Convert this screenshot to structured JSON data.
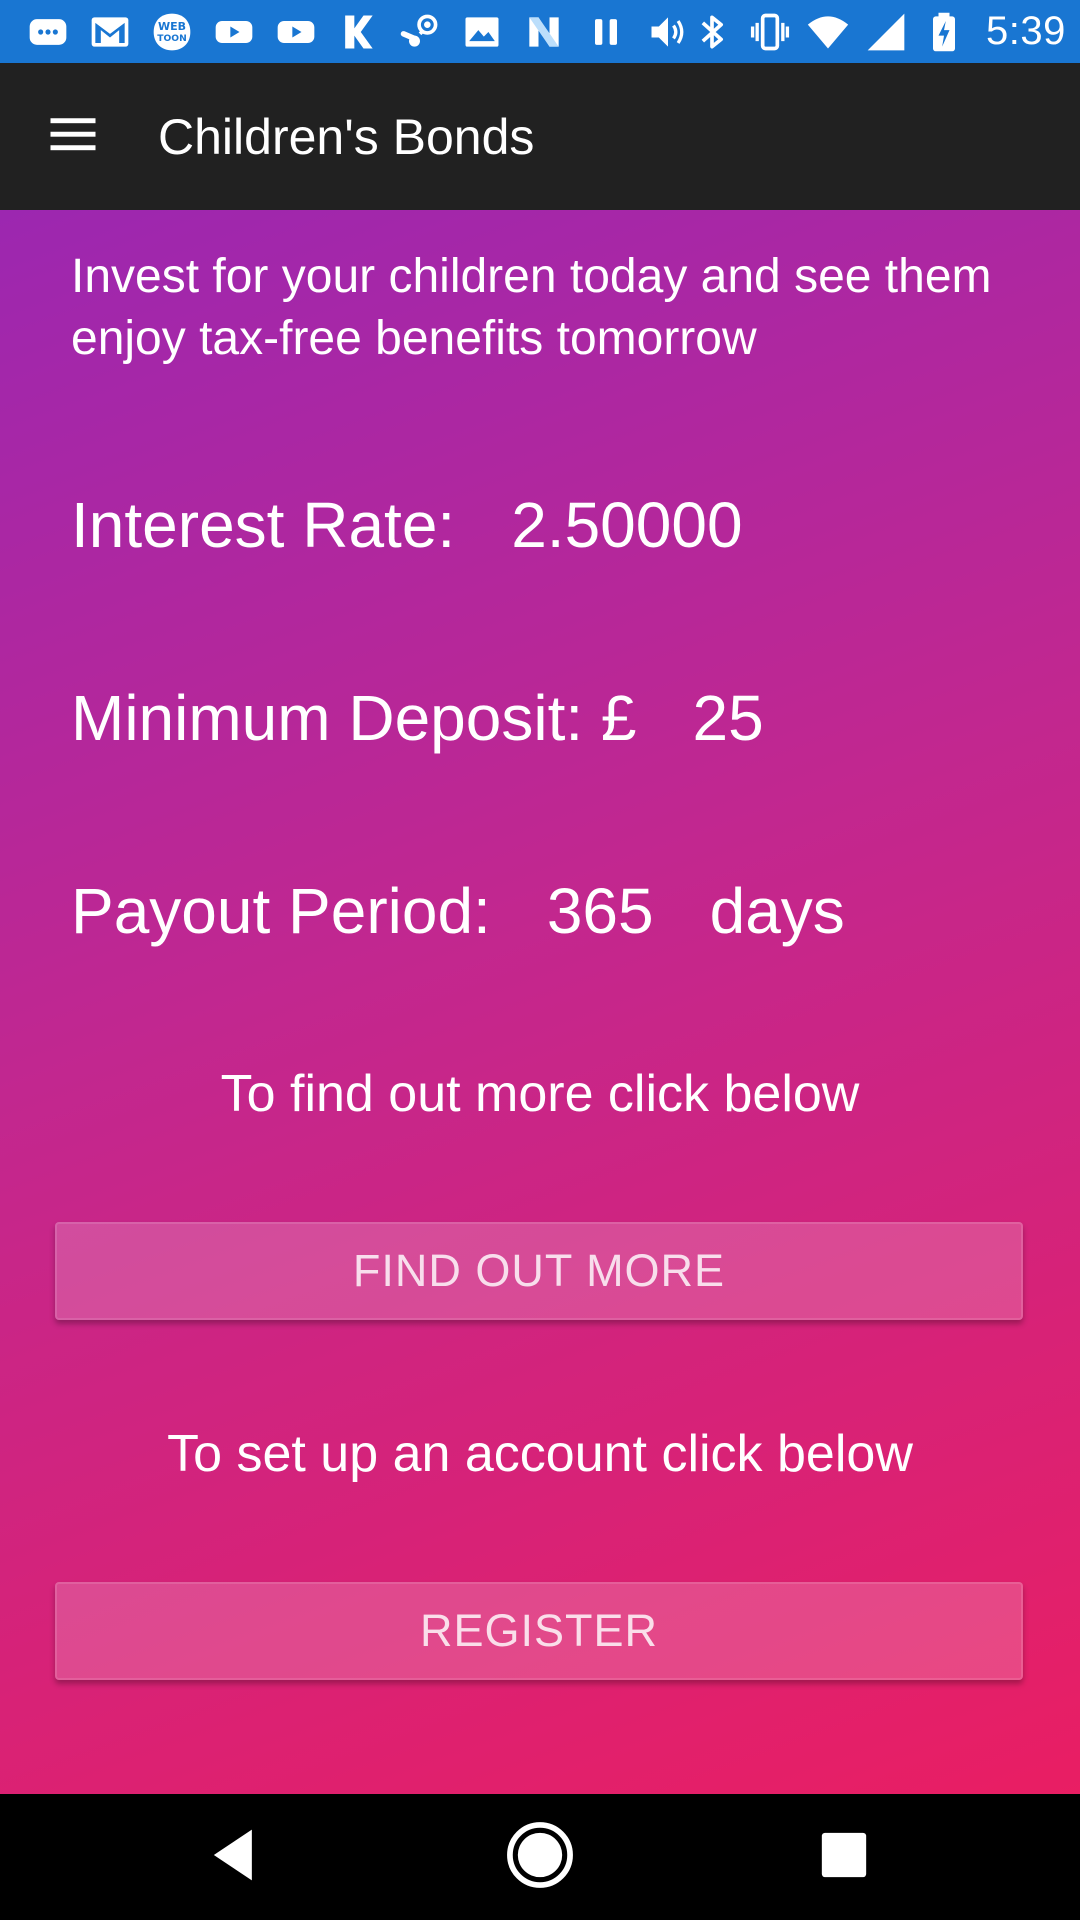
{
  "status_bar": {
    "time": "5:39",
    "left_icons": [
      "messages-icon",
      "gmail-icon",
      "webtoon-icon",
      "youtube-icon",
      "youtube-icon",
      "k-app-icon",
      "steam-icon",
      "photos-icon",
      "n-app-icon",
      "pause-icon",
      "volume-icon"
    ],
    "right_icons": [
      "bluetooth-icon",
      "vibrate-icon",
      "wifi-icon",
      "cell-signal-icon",
      "battery-charging-icon"
    ],
    "background": "#1976d2"
  },
  "app_bar": {
    "title": "Children's Bonds",
    "menu_icon": "hamburger-menu-icon",
    "background": "#212121"
  },
  "content": {
    "tagline": "Invest for your children today and see them enjoy tax-free benefits tomorrow",
    "interest_rate_label": "Interest Rate:",
    "interest_rate_value": "2.50000",
    "min_deposit_label": "Minimum Deposit: £",
    "min_deposit_value": "25",
    "payout_label": "Payout Period:",
    "payout_value": "365",
    "payout_unit": "days",
    "find_out_prompt": "To find out more click below",
    "find_out_button": "FIND OUT MORE",
    "account_prompt": "To set up an account click below",
    "register_button": "REGISTER",
    "gradient_start": "#9c27b0",
    "gradient_end": "#e91e63"
  },
  "nav_bar": {
    "icons": [
      "back-icon",
      "home-icon",
      "recent-apps-icon"
    ]
  }
}
